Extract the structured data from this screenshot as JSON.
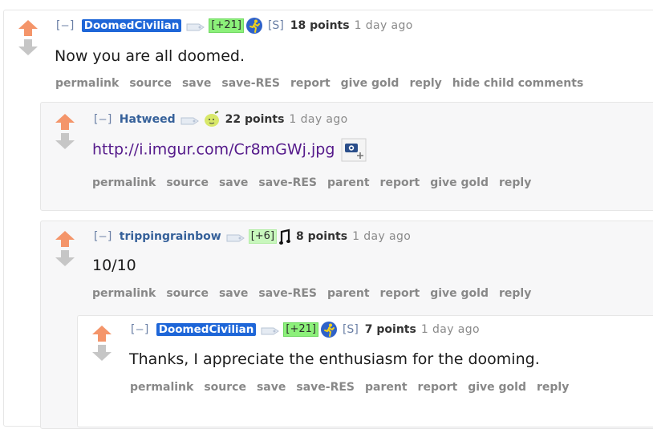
{
  "comments": [
    {
      "expand": "[–]",
      "author": "DoomedCivilian",
      "karma": "[+21]",
      "submitter": "[S]",
      "score": "18 points",
      "time": "1 day ago",
      "body": "Now you are all doomed.",
      "buttons": [
        "permalink",
        "source",
        "save",
        "save-RES",
        "report",
        "give gold",
        "reply",
        "hide child comments"
      ],
      "flair_icon": "blue-runner-icon"
    },
    {
      "expand": "[–]",
      "author": "Hatweed",
      "score": "22 points",
      "time": "1 day ago",
      "link": "http://i.imgur.com/Cr8mGWj.jpg",
      "buttons": [
        "permalink",
        "source",
        "save",
        "save-RES",
        "parent",
        "report",
        "give gold",
        "reply"
      ],
      "flair_icon": "lemon-face-icon"
    },
    {
      "expand": "[–]",
      "author": "trippingrainbow",
      "karma": "[+6]",
      "score": "8 points",
      "time": "1 day ago",
      "body": "10/10",
      "buttons": [
        "permalink",
        "source",
        "save",
        "save-RES",
        "parent",
        "report",
        "give gold",
        "reply"
      ],
      "flair_icon": "music-note-icon"
    },
    {
      "expand": "[–]",
      "author": "DoomedCivilian",
      "karma": "[+21]",
      "submitter": "[S]",
      "score": "7 points",
      "time": "1 day ago",
      "body": "Thanks, I appreciate the enthusiasm for the dooming.",
      "buttons": [
        "permalink",
        "source",
        "save",
        "save-RES",
        "parent",
        "report",
        "give gold",
        "reply"
      ],
      "flair_icon": "blue-runner-icon"
    }
  ],
  "colors": {
    "upvote": "#f4956a",
    "downvote": "#c6c6c6",
    "op_badge": "#1e66d8",
    "karma_badge": "#8cf07a",
    "link": "#551a8b"
  }
}
